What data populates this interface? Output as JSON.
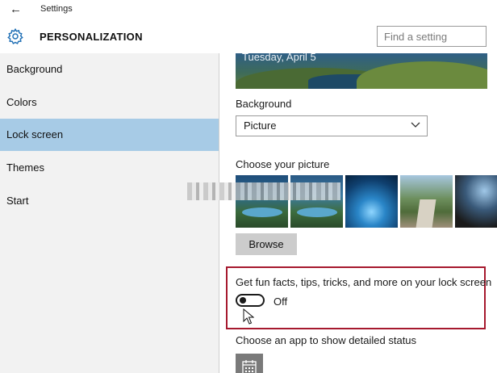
{
  "titlebar": {
    "back_glyph": "←",
    "title": "Settings"
  },
  "header": {
    "section_title": "PERSONALIZATION",
    "search_placeholder": "Find a setting"
  },
  "sidebar": {
    "items": [
      {
        "label": "Background",
        "active": false
      },
      {
        "label": "Colors",
        "active": false
      },
      {
        "label": "Lock screen",
        "active": true
      },
      {
        "label": "Themes",
        "active": false
      },
      {
        "label": "Start",
        "active": false
      }
    ]
  },
  "content": {
    "preview_date": "Tuesday, April 5",
    "background_label": "Background",
    "background_value": "Picture",
    "choose_picture_label": "Choose your picture",
    "browse_label": "Browse",
    "fun_facts_label": "Get fun facts, tips, tricks, and more on your lock screen",
    "toggle_state": "Off",
    "detailed_status_label": "Choose an app to show detailed status"
  },
  "colors": {
    "accent_selected": "#a7cbe6",
    "highlight_border": "#a6192e",
    "sidebar_bg": "#f2f2f2"
  },
  "icons": [
    "back-arrow-icon",
    "gear-icon",
    "chevron-down-icon",
    "cursor-icon",
    "calendar-icon"
  ]
}
